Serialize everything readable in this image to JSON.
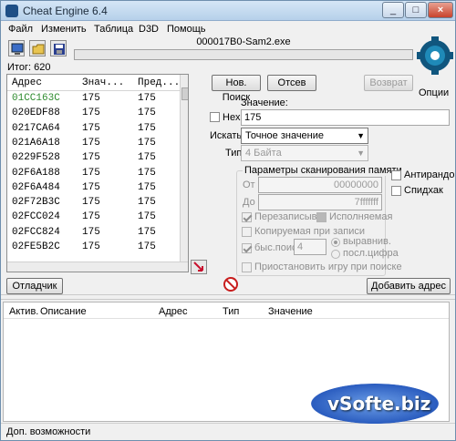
{
  "window": {
    "title": "Cheat Engine 6.4"
  },
  "menu": [
    "Файл",
    "Изменить",
    "Таблица",
    "D3D",
    "Помощь"
  ],
  "process": {
    "name": "000017B0-Sam2.exe"
  },
  "found": {
    "label": "Итог:",
    "count": "620"
  },
  "options_label": "Опции",
  "results": {
    "headers": [
      "Адрес",
      "Знач...",
      "Пред..."
    ],
    "rows": [
      {
        "address": "01CC163C",
        "value": "175",
        "previous": "175",
        "color": "#2e8b2e"
      },
      {
        "address": "020EDF88",
        "value": "175",
        "previous": "175"
      },
      {
        "address": "0217CA64",
        "value": "175",
        "previous": "175"
      },
      {
        "address": "021A6A18",
        "value": "175",
        "previous": "175"
      },
      {
        "address": "0229F528",
        "value": "175",
        "previous": "175"
      },
      {
        "address": "02F6A188",
        "value": "175",
        "previous": "175"
      },
      {
        "address": "02F6A484",
        "value": "175",
        "previous": "175"
      },
      {
        "address": "02F72B3C",
        "value": "175",
        "previous": "175"
      },
      {
        "address": "02FCC024",
        "value": "175",
        "previous": "175"
      },
      {
        "address": "02FCC824",
        "value": "175",
        "previous": "175"
      },
      {
        "address": "02FE5B2C",
        "value": "175",
        "previous": "175"
      }
    ]
  },
  "scan": {
    "new_scan": "Нов. Поиск",
    "next_scan": "Отсев",
    "undo": "Возврат",
    "value_label": "Значение:",
    "hex_label": "Hex",
    "value": "175",
    "search_label": "Искать",
    "search_type": "Точное значение",
    "type_label": "Тип",
    "value_type": "4 Байта"
  },
  "memory": {
    "title": "Параметры сканирования памяти",
    "from_label": "От",
    "from_value": "00000000",
    "to_label": "До",
    "to_value": "7fffffff",
    "writable": "Перезаписыв.",
    "executable": "Исполняемая",
    "copy_on_write": "Копируемая при записи",
    "fast_scan": "быс.поиск",
    "fast_value": "4",
    "alignment": "выравнив.",
    "last_digits": "посл.цифра",
    "pause_game": "Приостановить игру при поиске"
  },
  "extra": {
    "unrandomizer": "Антирандом",
    "speedhack": "Спидхак"
  },
  "buttons": {
    "debugger": "Отладчик",
    "add_address": "Добавить адрес"
  },
  "cheat_table": {
    "headers": [
      "Актив.",
      "Описание",
      "Адрес",
      "Тип",
      "Значение"
    ]
  },
  "status": {
    "advanced": "Доп. возможности"
  },
  "watermark": "vSofte.biz"
}
